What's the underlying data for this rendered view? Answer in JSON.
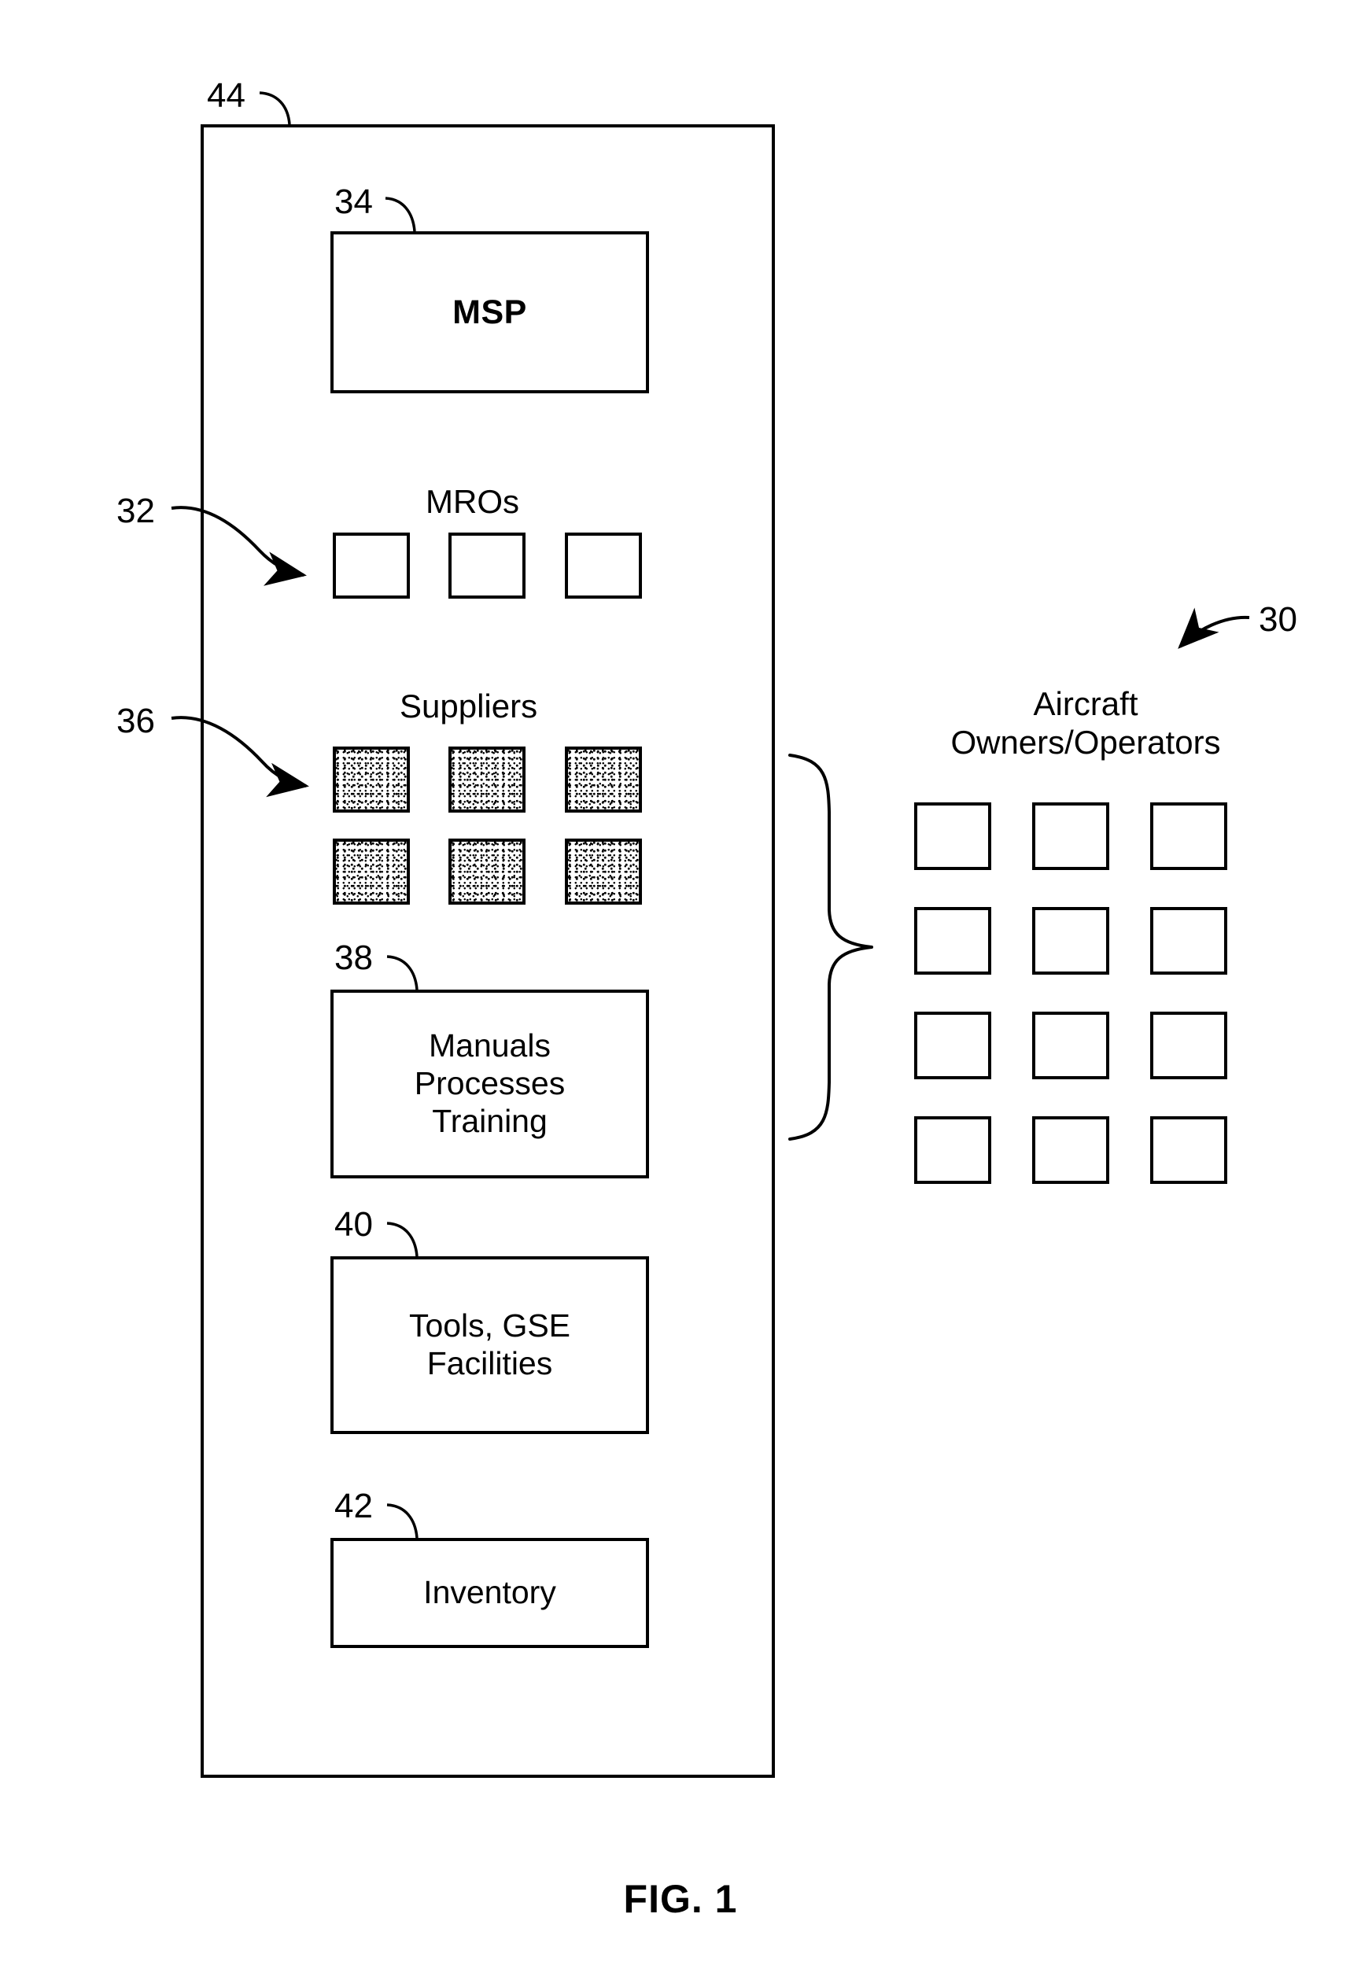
{
  "figure": {
    "caption": "FIG. 1"
  },
  "outer_container": {
    "ref": "44"
  },
  "msp": {
    "ref": "34",
    "label": "MSP"
  },
  "mros": {
    "ref": "32",
    "heading": "MROs",
    "count": 3,
    "fill": "empty"
  },
  "suppliers": {
    "ref": "36",
    "heading": "Suppliers",
    "count": 6,
    "columns": 3,
    "rows": 2,
    "fill": "stippled"
  },
  "manuals": {
    "ref": "38",
    "label": "Manuals\nProcesses\nTraining"
  },
  "tools": {
    "ref": "40",
    "label": "Tools, GSE\nFacilities"
  },
  "inventory": {
    "ref": "42",
    "label": "Inventory"
  },
  "owners": {
    "ref": "30",
    "heading": "Aircraft\nOwners/Operators",
    "columns": 3,
    "rows": 4,
    "count": 12,
    "fill": "empty"
  },
  "colors": {
    "line": "#000000",
    "background": "#ffffff",
    "fill": "#ffffff"
  }
}
